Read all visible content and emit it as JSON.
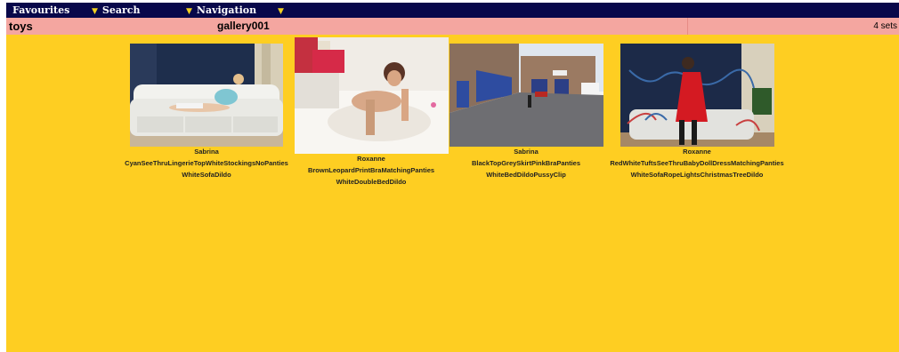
{
  "nav": {
    "items": [
      {
        "label": "Favourites"
      },
      {
        "label": "Search"
      },
      {
        "label": "Navigation"
      }
    ]
  },
  "titlebar": {
    "category": "toys",
    "gallery": "gallery001",
    "count": "4 sets"
  },
  "galleries": [
    {
      "name": "Sabrina",
      "line1": "CyanSeeThruLingerieTopWhiteStockingsNoPanties",
      "line2": "WhiteSofaDildo"
    },
    {
      "name": "Roxanne",
      "line1": "BrownLeopardPrintBraMatchingPanties",
      "line2": "WhiteDoubleBedDildo"
    },
    {
      "name": "Sabrina",
      "line1": "BlackTopGreySkirtPinkBraPanties",
      "line2": "WhiteBedDildoPussyClip"
    },
    {
      "name": "Roxanne",
      "line1": "RedWhiteTuftsSeeThruBabyDollDressMatchingPanties",
      "line2": "WhiteSofaRopeLightsChristmasTreeDildo"
    }
  ],
  "colors": {
    "nav_bg": "#08084a",
    "title_bg": "#f4a6a0",
    "main_bg": "#fece22",
    "arrow": "#f0d020"
  },
  "icons": [
    "dropdown-arrow-icon"
  ]
}
